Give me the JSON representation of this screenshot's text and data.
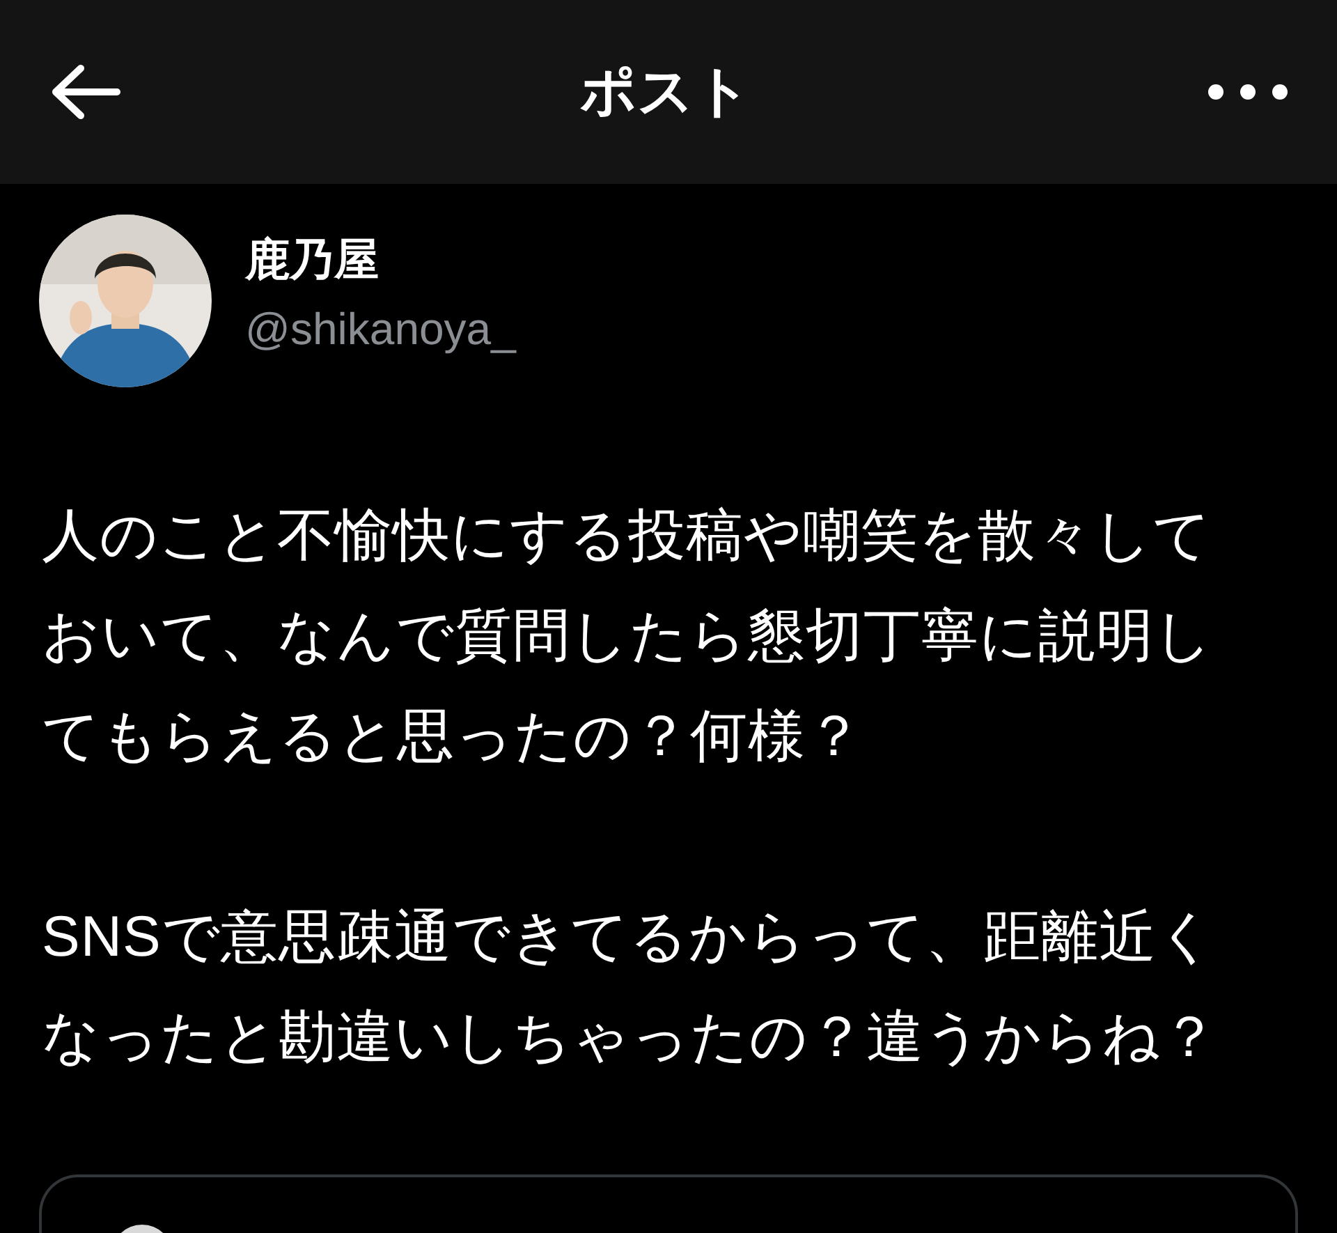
{
  "header": {
    "title": "ポスト"
  },
  "author": {
    "name": "鹿乃屋",
    "handle": "@shikanoya_"
  },
  "post": {
    "paragraphs": [
      "人のこと不愉快にする投稿や嘲笑を散々しておいて、なんで質問したら懇切丁寧に説明してもらえると思ったの？何様？",
      "SNSで意思疎通できてるからって、距離近くなったと勘違いしちゃったの？違うからね？"
    ]
  }
}
